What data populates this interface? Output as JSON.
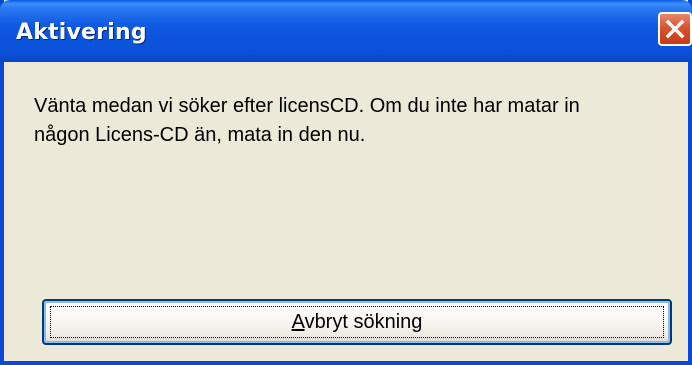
{
  "window": {
    "title": "Aktivering",
    "close_icon": "close-icon"
  },
  "message": {
    "text_line1": "Vänta medan vi söker efter licensCD.  Om du inte har matar in",
    "text_line2": "någon Licens-CD än, mata in den nu."
  },
  "buttons": {
    "cancel_access_key": "A",
    "cancel_label_rest": "vbryt sökning"
  },
  "colors": {
    "titlebar": "#0a54dc",
    "window_background": "#ece9d8",
    "close_button": "#d8542f"
  }
}
